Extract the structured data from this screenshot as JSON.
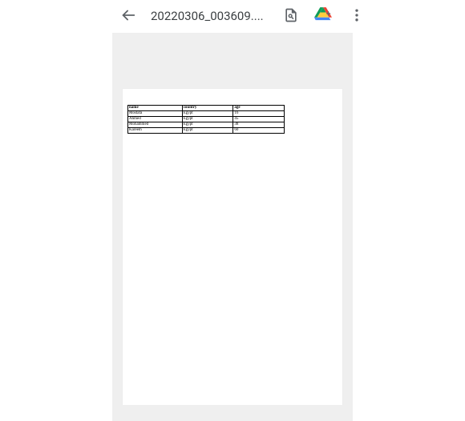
{
  "header": {
    "title": "20220306_003609....",
    "icons": {
      "back": "back-arrow",
      "find": "find-in-page",
      "drive": "google-drive",
      "overflow": "more-vert"
    }
  },
  "document": {
    "table": {
      "headers": [
        "name",
        "country",
        "age"
      ],
      "rows": [
        {
          "name": "Mostafa",
          "country": "Egypt",
          "age": "16"
        },
        {
          "name": "Ahmed",
          "country": "Egypt",
          "age": "45"
        },
        {
          "name": "Mohammed",
          "country": "Egypt",
          "age": "38"
        },
        {
          "name": "Kareem",
          "country": "Egypt",
          "age": "60"
        }
      ]
    }
  }
}
